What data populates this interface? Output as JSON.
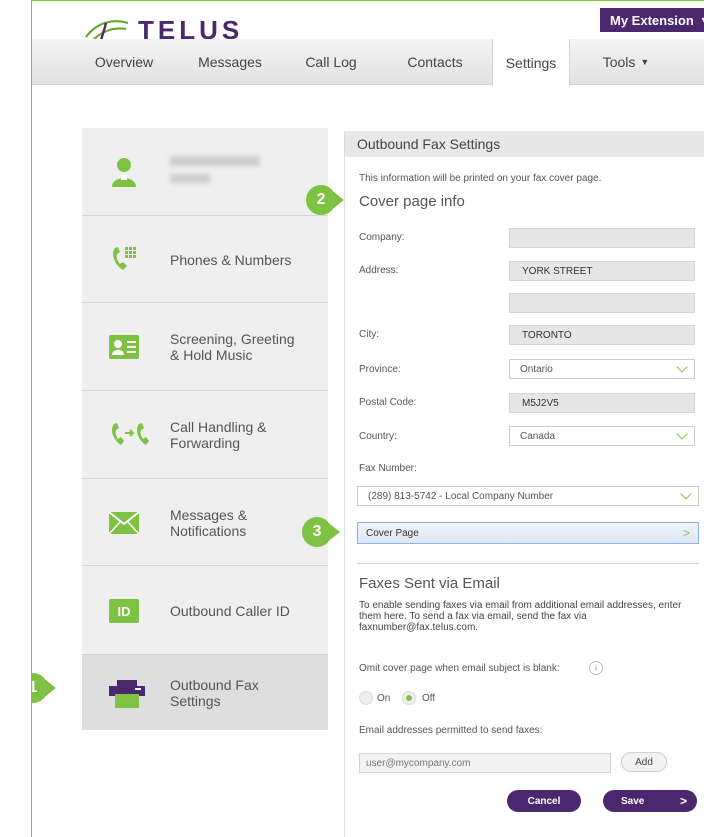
{
  "brand": {
    "name": "TELUS"
  },
  "header": {
    "extension_label": "My Extension"
  },
  "nav": {
    "items": [
      {
        "label": "Overview"
      },
      {
        "label": "Messages"
      },
      {
        "label": "Call Log"
      },
      {
        "label": "Contacts"
      },
      {
        "label": "Settings"
      },
      {
        "label": "Tools"
      }
    ],
    "active": "Settings"
  },
  "sidebar": {
    "items": [
      {
        "label": "",
        "icon": "user-icon"
      },
      {
        "label": "Phones & Numbers",
        "icon": "phone-keypad-icon"
      },
      {
        "label": "Screening, Greeting\n& Hold Music",
        "icon": "id-card-icon"
      },
      {
        "label": "Call Handling &\nForwarding",
        "icon": "call-forward-icon"
      },
      {
        "label": "Messages &\nNotifications",
        "icon": "envelope-icon"
      },
      {
        "label": "Outbound Caller ID",
        "icon": "caller-id-icon"
      },
      {
        "label": "Outbound Fax\nSettings",
        "icon": "fax-icon"
      }
    ],
    "selected": "Outbound Fax Settings"
  },
  "callouts": [
    "1",
    "2",
    "3"
  ],
  "panel": {
    "title": "Outbound Fax Settings",
    "intro": "This information will be printed on your fax cover page.",
    "cover_section": "Cover page info",
    "company_label": "Company:",
    "company_value": "",
    "address_label": "Address:",
    "address_line1": "YORK STREET",
    "address_line2": "",
    "city_label": "City:",
    "city_value": "TORONTO",
    "province_label": "Province:",
    "province_value": "Ontario",
    "postal_label": "Postal Code:",
    "postal_value": "M5J2V5",
    "country_label": "Country:",
    "country_value": "Canada",
    "fax_label": "Fax Number:",
    "fax_value": "(289) 813-5742 - Local Company Number",
    "cover_button": "Cover Page",
    "email_section": "Faxes Sent via Email",
    "email_para": "To enable sending faxes via email from additional email addresses, enter them here. To send a fax via email, send the fax via faxnumber@fax.telus.com.",
    "omit_label": "Omit cover page when email subject is blank:",
    "radio_on": "On",
    "radio_off": "Off",
    "radio_selected": "Off",
    "permitted_label": "Email addresses permitted to send faxes:",
    "email_placeholder": "user@mycompany.com",
    "add_label": "Add",
    "cancel_label": "Cancel",
    "save_label": "Save"
  },
  "colors": {
    "brand_purple": "#4b286d",
    "brand_green": "#7dc242",
    "focus_blue": "#8fb2d9"
  }
}
